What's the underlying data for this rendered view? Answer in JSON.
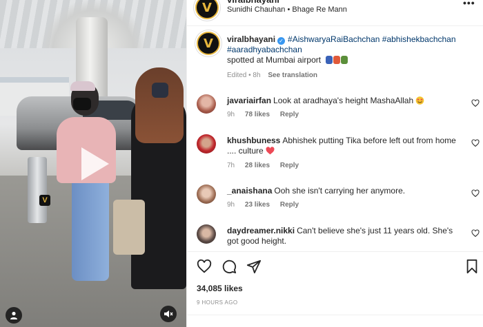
{
  "post_header": {
    "username": "viralbhayani",
    "audio_artist": "Sunidhi Chauhan",
    "audio_separator": " • ",
    "audio_track": "Bhage Re Mann",
    "more_label": "•••",
    "avatar_letter": "V"
  },
  "caption": {
    "username": "viralbhayani",
    "verified_mark": "✓",
    "hashtags": [
      "#AishwaryaRaiBachchan",
      "#abhishekbachchan",
      "#aaradhyabachchan"
    ],
    "text": "spotted at Mumbai airport",
    "edited": "Edited • 8h",
    "see_translation": "See translation"
  },
  "comments": [
    {
      "username": "javariairfan",
      "text": "Look at aradhaya's height MashaAllah ",
      "time": "9h",
      "likes": "78 likes",
      "reply": "Reply"
    },
    {
      "username": "khushbuness",
      "text": "Abhishek putting Tika before left out from home .... culture ",
      "time": "7h",
      "likes": "28 likes",
      "reply": "Reply"
    },
    {
      "username": "_anaishana",
      "text": "Ooh she isn't carrying her anymore.",
      "time": "9h",
      "likes": "23 likes",
      "reply": "Reply"
    },
    {
      "username": "daydreamer.nikki",
      "text": "Can't believe she's just 11 years old. She's got good height.",
      "time": "",
      "likes": "",
      "reply": ""
    }
  ],
  "actions": {
    "likes_count": "34,085 likes",
    "timestamp": "9 HOURS AGO"
  },
  "video": {
    "watermark": "V"
  },
  "colors": {
    "brand_gold": "#e7b63c",
    "link_blue": "#00376b",
    "verified_blue": "#3897f0",
    "heart_red": "#ed4956"
  }
}
